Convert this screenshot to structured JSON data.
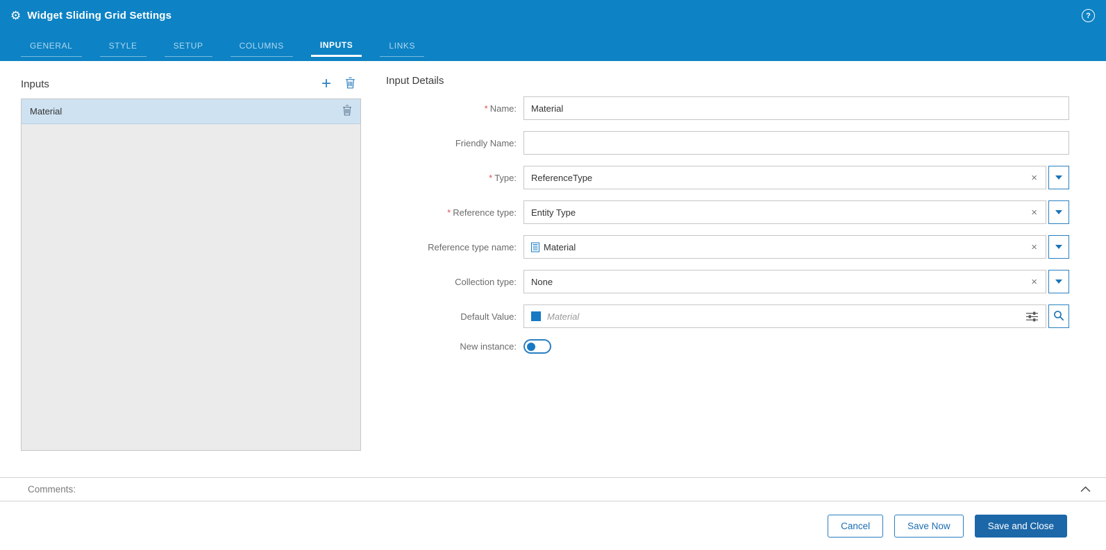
{
  "header": {
    "title": "Widget Sliding Grid Settings",
    "tabs": [
      "GENERAL",
      "STYLE",
      "SETUP",
      "COLUMNS",
      "INPUTS",
      "LINKS"
    ],
    "active_tab": "INPUTS",
    "icons": {
      "gear": "⚙",
      "help": "?"
    }
  },
  "inputs_panel": {
    "title": "Inputs",
    "items": [
      {
        "label": "Material",
        "selected": true
      }
    ],
    "icons": {
      "add": "+",
      "delete": "trash-icon"
    }
  },
  "details": {
    "title": "Input Details",
    "fields": {
      "name": {
        "label": "Name:",
        "required": "*",
        "value": "Material"
      },
      "friendly_name": {
        "label": "Friendly Name:",
        "required": "",
        "value": ""
      },
      "type": {
        "label": "Type:",
        "required": "*",
        "value": "ReferenceType"
      },
      "reference_type": {
        "label": "Reference type:",
        "required": "*",
        "value": "Entity Type"
      },
      "reference_type_name": {
        "label": "Reference type name:",
        "required": "",
        "value": "Material"
      },
      "collection_type": {
        "label": "Collection type:",
        "required": "",
        "value": "None"
      },
      "default_value": {
        "label": "Default Value:",
        "required": "",
        "placeholder": "Material"
      },
      "new_instance": {
        "label": "New instance:",
        "required": "",
        "state": "off"
      }
    },
    "combo_icons": {
      "clear": "×",
      "dropdown": "caret-down"
    }
  },
  "comments": {
    "label": "Comments:"
  },
  "footer": {
    "cancel": "Cancel",
    "save_now": "Save Now",
    "save_and_close": "Save and Close"
  },
  "colors": {
    "header_blue": "#0d82c4",
    "primary_button_blue": "#1b67a8",
    "accent_border_blue": "#2a7fc0",
    "selected_row_blue": "#cfe2f1",
    "required_marker_red": "#d9534f"
  }
}
